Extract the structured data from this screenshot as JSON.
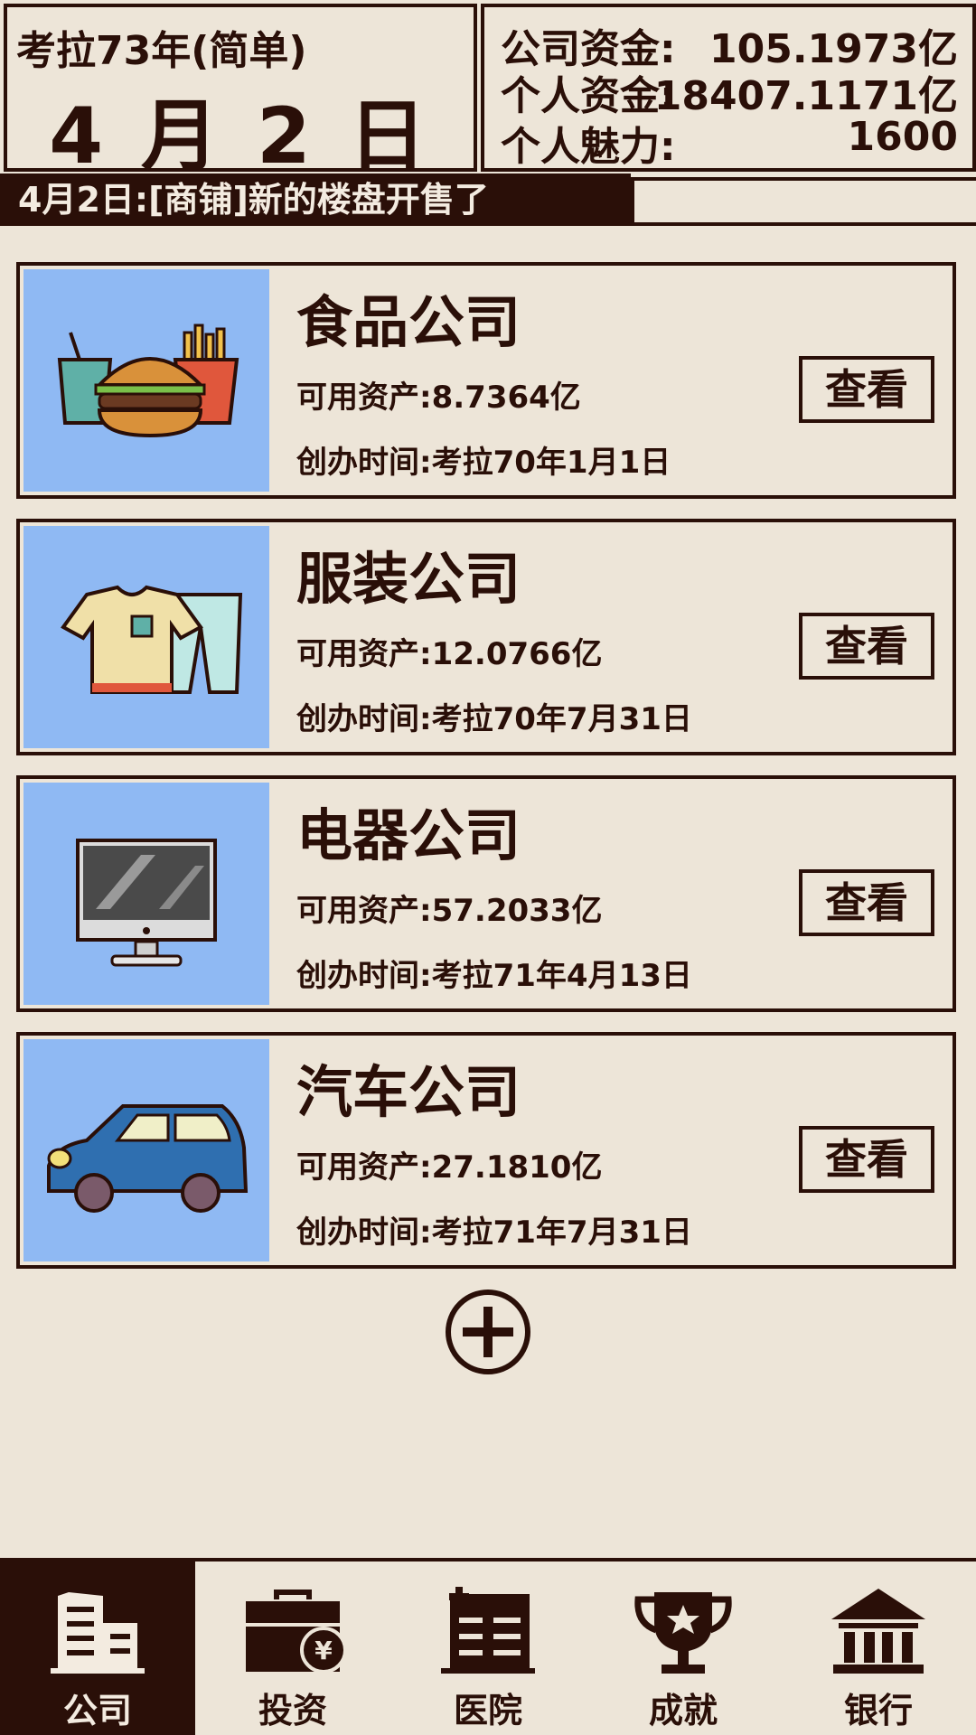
{
  "header": {
    "year_label": "考拉73年(简单)",
    "date": "4 月 2 日",
    "stats": [
      {
        "label": "公司资金:",
        "value": "105.1973亿"
      },
      {
        "label": "个人资金:",
        "value": "18407.1171亿"
      },
      {
        "label": "个人魅力:",
        "value": "1600"
      }
    ]
  },
  "ticker": "4月2日:[商铺]新的楼盘开售了",
  "companies": [
    {
      "name": "食品公司",
      "assets": "可用资产:8.7364亿",
      "founded": "创办时间:考拉70年1月1日",
      "button": "查看",
      "icon": "burger-fries-icon"
    },
    {
      "name": "服装公司",
      "assets": "可用资产:12.0766亿",
      "founded": "创办时间:考拉70年7月31日",
      "button": "查看",
      "icon": "clothes-icon"
    },
    {
      "name": "电器公司",
      "assets": "可用资产:57.2033亿",
      "founded": "创办时间:考拉71年4月13日",
      "button": "查看",
      "icon": "monitor-icon"
    },
    {
      "name": "汽车公司",
      "assets": "可用资产:27.1810亿",
      "founded": "创办时间:考拉71年7月31日",
      "button": "查看",
      "icon": "car-icon"
    }
  ],
  "add_button_icon": "plus-circle-icon",
  "nav": [
    {
      "label": "公司",
      "icon": "building-icon",
      "active": true
    },
    {
      "label": "投资",
      "icon": "briefcase-yen-icon",
      "active": false
    },
    {
      "label": "医院",
      "icon": "hospital-icon",
      "active": false
    },
    {
      "label": "成就",
      "icon": "trophy-icon",
      "active": false
    },
    {
      "label": "银行",
      "icon": "bank-icon",
      "active": false
    }
  ],
  "colors": {
    "ink": "#2a0f08",
    "background": "#ede5d8",
    "thumb_bg": "#8fb9f3",
    "active_nav_text": "#f3ebe0"
  }
}
